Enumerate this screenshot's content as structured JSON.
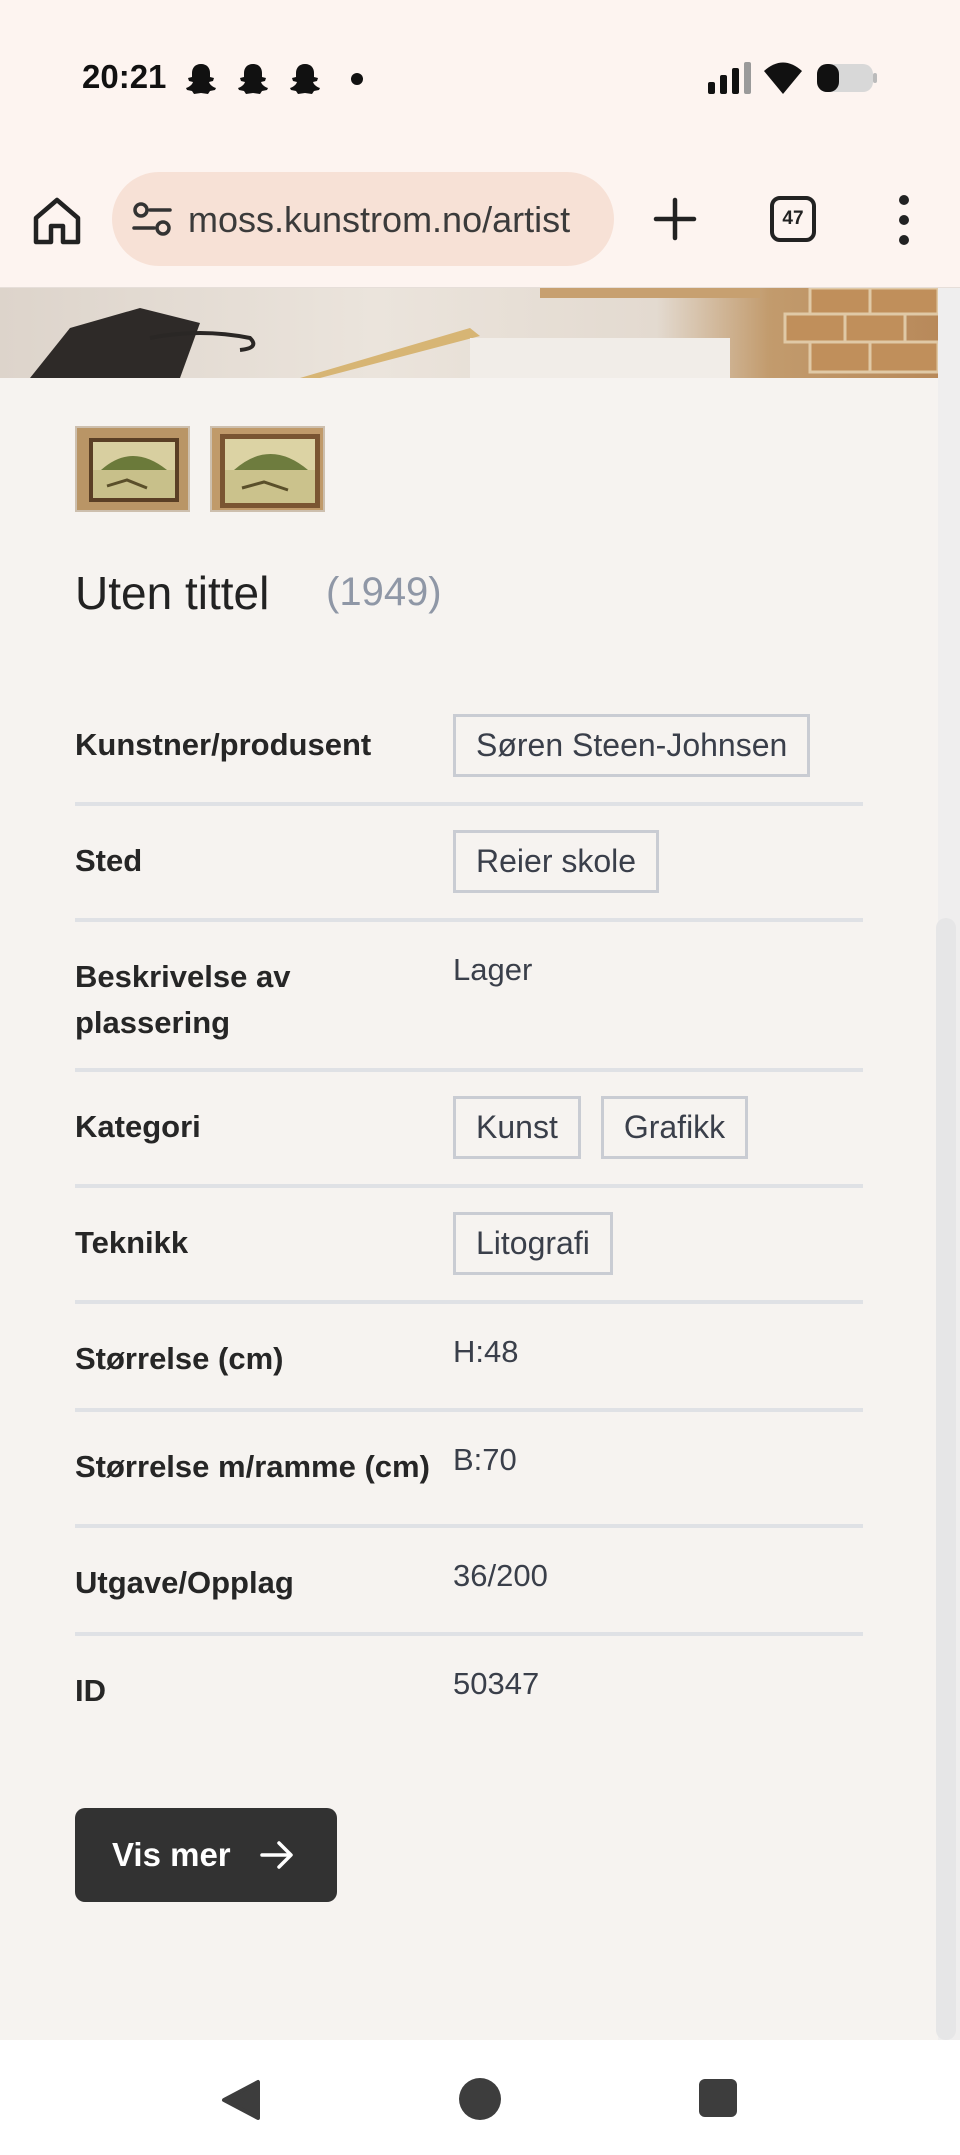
{
  "status_bar": {
    "time": "20:21",
    "notification_icons": [
      "snapchat-icon",
      "snapchat-icon",
      "snapchat-icon"
    ],
    "battery_level": 0.35
  },
  "browser": {
    "url": "moss.kunstrom.no/artist",
    "tab_count": "47"
  },
  "artwork": {
    "title": "Uten tittel",
    "year": "(1949)",
    "thumbnail_count": 2,
    "details": [
      {
        "label": "Kunstner/produsent",
        "tags": [
          "Søren Steen-Johnsen"
        ]
      },
      {
        "label": "Sted",
        "tags": [
          "Reier skole"
        ]
      },
      {
        "label": "Beskrivelse av plassering",
        "value": "Lager"
      },
      {
        "label": "Kategori",
        "tags": [
          "Kunst",
          "Grafikk"
        ]
      },
      {
        "label": "Teknikk",
        "tags": [
          "Litografi"
        ]
      },
      {
        "label": "Størrelse (cm)",
        "value": "H:48"
      },
      {
        "label": "Størrelse m/ramme (cm)",
        "value": "B:70"
      },
      {
        "label": "Utgave/Opplag",
        "value": "36/200"
      },
      {
        "label": "ID",
        "value": "50347"
      }
    ]
  },
  "actions": {
    "more_label": "Vis mer"
  }
}
